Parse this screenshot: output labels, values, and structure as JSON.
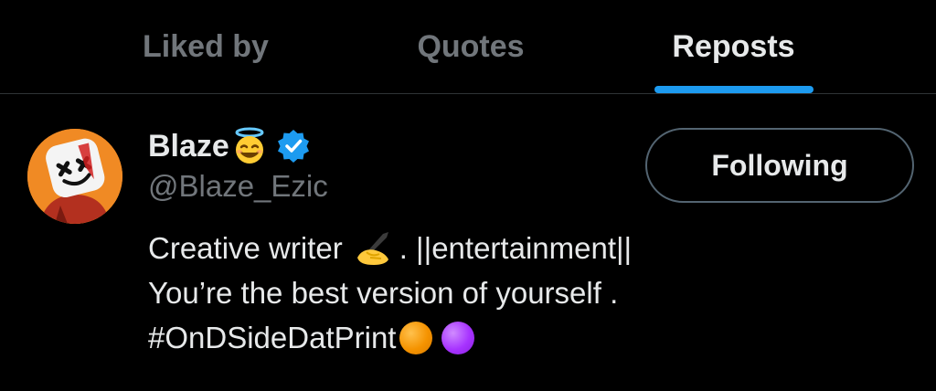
{
  "tabs": [
    {
      "label": "Liked by",
      "active": false
    },
    {
      "label": "Quotes",
      "active": false
    },
    {
      "label": "Reposts",
      "active": true
    }
  ],
  "colors": {
    "accent": "#1d9bf0",
    "background": "#000000",
    "text_primary": "#e7e9ea",
    "text_secondary": "#71767b",
    "avatar_bg": "#f08a24"
  },
  "user": {
    "display_name": "Blaze",
    "name_emoji": "smiling-face-with-halo",
    "verified": true,
    "handle": "@Blaze_Ezic",
    "follow_button_label": "Following",
    "bio": {
      "line1_text_a": "Creative writer",
      "line1_emoji": "writing-hand",
      "line1_text_b": ". ||entertainment||",
      "line2": "You’re the best version of yourself .",
      "line3_hashtag": "#OnDSideDatPrint",
      "line3_emojis": [
        "orange-circle",
        "purple-circle"
      ]
    }
  }
}
